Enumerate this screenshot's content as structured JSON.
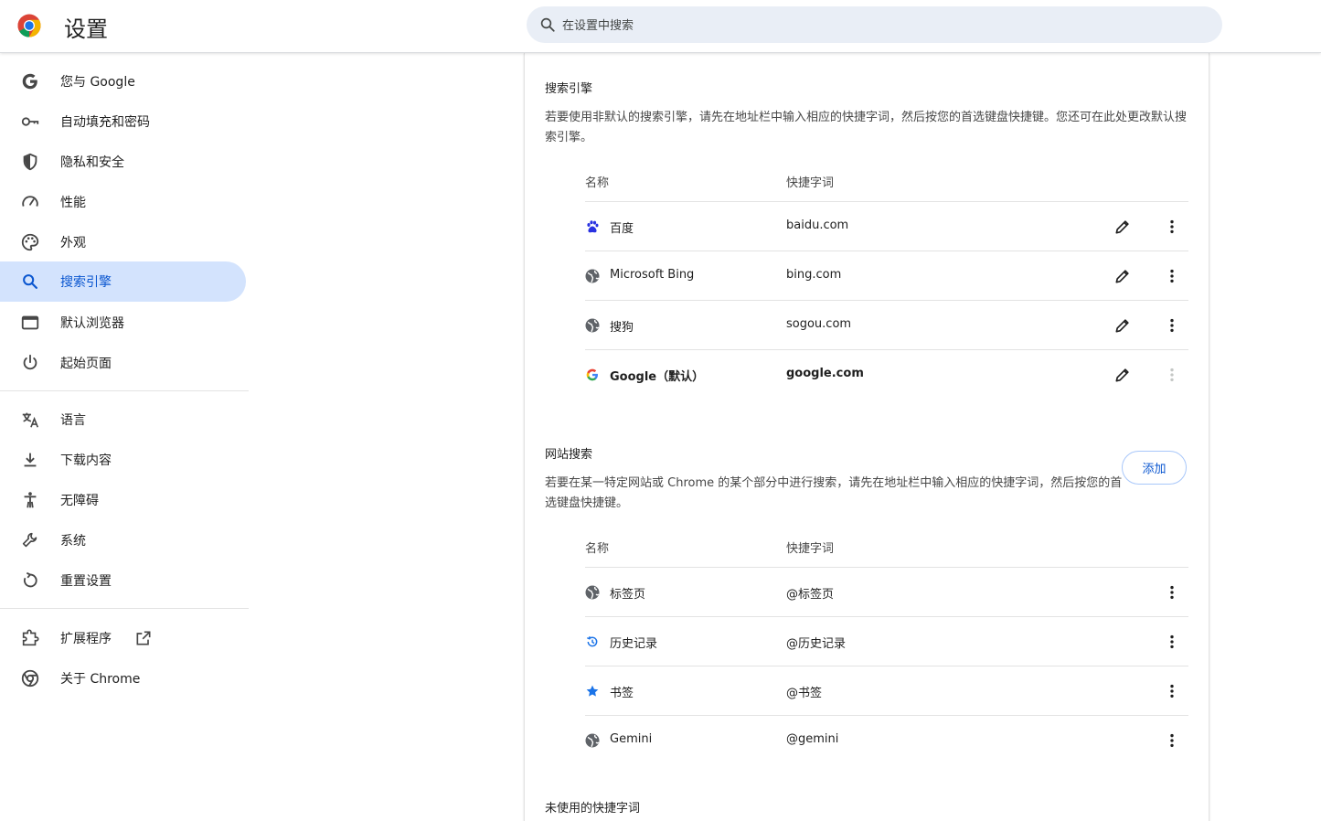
{
  "header": {
    "title": "设置",
    "search_placeholder": "在设置中搜索"
  },
  "sidebar": {
    "items": [
      {
        "label": "您与 Google",
        "icon": "google-g-icon"
      },
      {
        "label": "自动填充和密码",
        "icon": "key-icon"
      },
      {
        "label": "隐私和安全",
        "icon": "shield-icon"
      },
      {
        "label": "性能",
        "icon": "speedometer-icon"
      },
      {
        "label": "外观",
        "icon": "palette-icon"
      },
      {
        "label": "搜索引擎",
        "icon": "search-icon",
        "active": true
      },
      {
        "label": "默认浏览器",
        "icon": "browser-window-icon"
      },
      {
        "label": "起始页面",
        "icon": "power-icon"
      },
      {
        "label": "语言",
        "icon": "translate-icon"
      },
      {
        "label": "下载内容",
        "icon": "download-icon"
      },
      {
        "label": "无障碍",
        "icon": "accessibility-icon"
      },
      {
        "label": "系统",
        "icon": "wrench-icon"
      },
      {
        "label": "重置设置",
        "icon": "reset-icon"
      },
      {
        "label": "扩展程序",
        "icon": "puzzle-icon"
      },
      {
        "label": "关于 Chrome",
        "icon": "chrome-icon"
      }
    ]
  },
  "search_engines": {
    "title": "搜索引擎",
    "description": "若要使用非默认的搜索引擎，请先在地址栏中输入相应的快捷字词，然后按您的首选键盘快捷键。您还可在此处更改默认搜索引擎。",
    "col_name": "名称",
    "col_keyword": "快捷字词",
    "rows": [
      {
        "name": "百度",
        "keyword": "baidu.com",
        "icon": "baidu-paw-icon"
      },
      {
        "name": "Microsoft Bing",
        "keyword": "bing.com",
        "icon": "globe-icon"
      },
      {
        "name": "搜狗",
        "keyword": "sogou.com",
        "icon": "globe-icon"
      },
      {
        "name": "Google（默认）",
        "keyword": "google.com",
        "icon": "google-g-icon",
        "default": true
      }
    ]
  },
  "site_search": {
    "title": "网站搜索",
    "add_label": "添加",
    "description": "若要在某一特定网站或 Chrome 的某个部分中进行搜索，请先在地址栏中输入相应的快捷字词，然后按您的首选键盘快捷键。",
    "col_name": "名称",
    "col_keyword": "快捷字词",
    "rows": [
      {
        "name": "标签页",
        "keyword": "@标签页",
        "icon": "globe-icon"
      },
      {
        "name": "历史记录",
        "keyword": "@历史记录",
        "icon": "history-icon"
      },
      {
        "name": "书签",
        "keyword": "@书签",
        "icon": "star-icon"
      },
      {
        "name": "Gemini",
        "keyword": "@gemini",
        "icon": "globe-icon"
      }
    ]
  },
  "inactive_shortcuts": {
    "title": "未使用的快捷字词"
  },
  "colors": {
    "accent": "#0b57d0",
    "active_bg": "#d3e3fd",
    "search_bg": "#e9eef6"
  }
}
